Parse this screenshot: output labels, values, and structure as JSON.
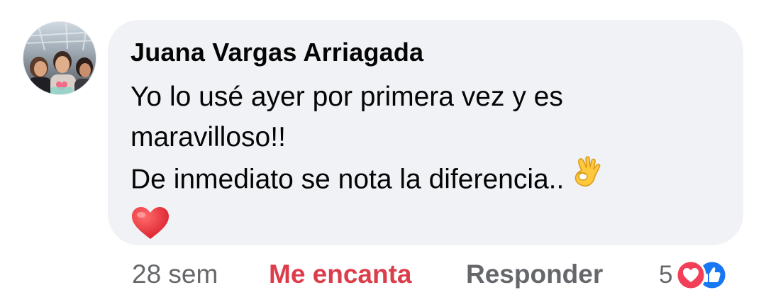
{
  "comment": {
    "author": "Juana Vargas Arriagada",
    "lines": [
      "Yo lo usé ayer por primera vez y es",
      "maravilloso!!",
      "De inmediato se nota la diferencia.."
    ],
    "emojis": {
      "line3_end": "ok-hand-icon",
      "line4": "red-heart-icon"
    },
    "avatar": "profile-photo-avatar"
  },
  "actions": {
    "time": "28 sem",
    "love_label": "Me encanta",
    "reply_label": "Responder"
  },
  "reactions": {
    "count": "5",
    "icons": [
      "love-reaction-icon",
      "like-reaction-icon"
    ]
  },
  "colors": {
    "bubble": "#f0f2f5",
    "text": "#050505",
    "secondary": "#65676b",
    "love": "#dc3d4b",
    "like": "#1877f2",
    "heart": "#f33e58"
  }
}
